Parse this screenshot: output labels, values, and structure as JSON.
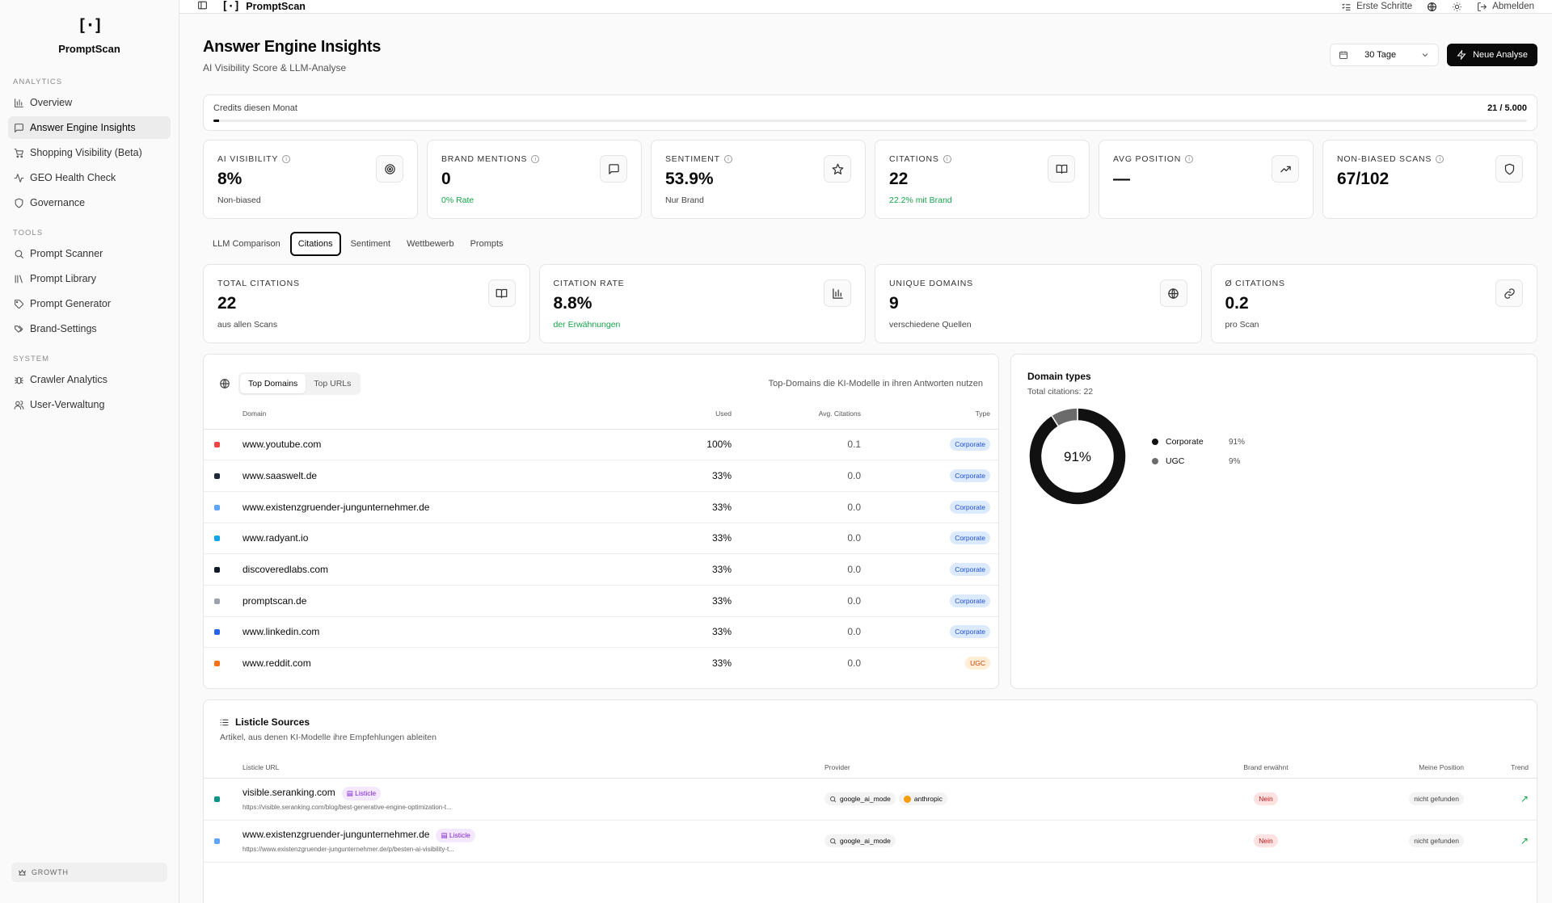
{
  "app": {
    "name": "PromptScan",
    "logo": "[·]"
  },
  "sidebar": {
    "sections": [
      {
        "heading": "ANALYTICS",
        "items": [
          {
            "label": "Overview",
            "icon": "bar-chart-icon"
          },
          {
            "label": "Answer Engine Insights",
            "icon": "message-square-icon",
            "active": true
          },
          {
            "label": "Shopping Visibility (Beta)",
            "icon": "cart-icon"
          },
          {
            "label": "GEO Health Check",
            "icon": "activity-icon"
          },
          {
            "label": "Governance",
            "icon": "shield-icon"
          }
        ]
      },
      {
        "heading": "TOOLS",
        "items": [
          {
            "label": "Prompt Scanner",
            "icon": "search-icon"
          },
          {
            "label": "Prompt Library",
            "icon": "library-icon"
          },
          {
            "label": "Prompt Generator",
            "icon": "tag-icon"
          },
          {
            "label": "Brand-Settings",
            "icon": "tags-icon"
          }
        ]
      },
      {
        "heading": "SYSTEM",
        "items": [
          {
            "label": "Crawler Analytics",
            "icon": "bug-icon"
          },
          {
            "label": "User-Verwaltung",
            "icon": "users-icon"
          }
        ]
      }
    ],
    "growth": "GROWTH"
  },
  "topbar": {
    "title": "PromptScan",
    "first_steps": "Erste Schritte",
    "logout": "Abmelden"
  },
  "page": {
    "title": "Answer Engine Insights",
    "subtitle": "AI Visibility Score & LLM-Analyse"
  },
  "range": {
    "selected": "30 Tage"
  },
  "new_analysis": "Neue Analyse",
  "credits": {
    "label": "Credits diesen Monat",
    "value": "21 / 5.000",
    "used_fraction": 0.0042
  },
  "kpis": [
    {
      "label": "AI VISIBILITY",
      "value": "8%",
      "sub": "Non-biased",
      "green": false,
      "icon": "target-icon"
    },
    {
      "label": "BRAND MENTIONS",
      "value": "0",
      "sub": "0% Rate",
      "green": true,
      "icon": "message-square-icon"
    },
    {
      "label": "SENTIMENT",
      "value": "53.9%",
      "sub": "Nur Brand",
      "green": false,
      "icon": "star-icon"
    },
    {
      "label": "CITATIONS",
      "value": "22",
      "sub": "22.2% mit Brand",
      "green": true,
      "icon": "book-icon"
    },
    {
      "label": "AVG POSITION",
      "value": "—",
      "sub": "",
      "green": false,
      "icon": "trending-up-icon"
    },
    {
      "label": "NON-BIASED SCANS",
      "value": "67/102",
      "sub": "",
      "green": false,
      "icon": "shield-icon"
    }
  ],
  "tabs": [
    "LLM Comparison",
    "Citations",
    "Sentiment",
    "Wettbewerb",
    "Prompts"
  ],
  "active_tab": 1,
  "citation_kpis": [
    {
      "label": "TOTAL CITATIONS",
      "value": "22",
      "sub": "aus allen Scans",
      "green": false,
      "icon": "book-icon"
    },
    {
      "label": "CITATION RATE",
      "value": "8.8%",
      "sub": "der Erwähnungen",
      "green": true,
      "icon": "bar-chart-icon"
    },
    {
      "label": "UNIQUE DOMAINS",
      "value": "9",
      "sub": "verschiedene Quellen",
      "green": false,
      "icon": "globe-icon"
    },
    {
      "label": "Ø CITATIONS",
      "value": "0.2",
      "sub": "pro Scan",
      "green": false,
      "icon": "link-icon"
    }
  ],
  "domains": {
    "seg": [
      "Top Domains",
      "Top URLs"
    ],
    "note": "Top-Domains die KI-Modelle in ihren Antworten nutzen",
    "headers": {
      "domain": "Domain",
      "used": "Used",
      "avg": "Avg. Citations",
      "type": "Type"
    },
    "rows": [
      {
        "domain": "www.youtube.com",
        "used": "100%",
        "avg": "0.1",
        "type": "Corporate",
        "color": "#ef4444"
      },
      {
        "domain": "www.saaswelt.de",
        "used": "33%",
        "avg": "0.0",
        "type": "Corporate",
        "color": "#1f2937"
      },
      {
        "domain": "www.existenzgruender-jungunternehmer.de",
        "used": "33%",
        "avg": "0.0",
        "type": "Corporate",
        "color": "#60a5fa"
      },
      {
        "domain": "www.radyant.io",
        "used": "33%",
        "avg": "0.0",
        "type": "Corporate",
        "color": "#0ea5e9"
      },
      {
        "domain": "discoveredlabs.com",
        "used": "33%",
        "avg": "0.0",
        "type": "Corporate",
        "color": "#111827"
      },
      {
        "domain": "promptscan.de",
        "used": "33%",
        "avg": "0.0",
        "type": "Corporate",
        "color": "#9ca3af"
      },
      {
        "domain": "www.linkedin.com",
        "used": "33%",
        "avg": "0.0",
        "type": "Corporate",
        "color": "#2563eb"
      },
      {
        "domain": "www.reddit.com",
        "used": "33%",
        "avg": "0.0",
        "type": "UGC",
        "color": "#f97316"
      }
    ]
  },
  "domain_types": {
    "title": "Domain types",
    "sub": "Total citations: 22",
    "center": "91%",
    "slices": [
      {
        "label": "Corporate",
        "pct_text": "91%",
        "value": 91,
        "color": "#111111"
      },
      {
        "label": "UGC",
        "pct_text": "9%",
        "value": 9,
        "color": "#6b6b6b"
      }
    ]
  },
  "listicle": {
    "title": "Listicle Sources",
    "sub": "Artikel, aus denen KI-Modelle ihre Empfehlungen ableiten",
    "headers": {
      "url": "Listicle URL",
      "provider": "Provider",
      "brand": "Brand erwähnt",
      "pos": "Meine Position",
      "trend": "Trend"
    },
    "rows": [
      {
        "domain": "visible.seranking.com",
        "tag": "Listicle",
        "url": "https://visible.seranking.com/blog/best-generative-engine-optimization-t...",
        "providers": [
          "google_ai_mode",
          "anthropic"
        ],
        "brand": "Nein",
        "pos": "nicht gefunden",
        "color": "#0d9488"
      },
      {
        "domain": "www.existenzgruender-jungunternehmer.de",
        "tag": "Listicle",
        "url": "https://www.existenzgruender-jungunternehmer.de/p/besten-ai-visibility-t...",
        "providers": [
          "google_ai_mode"
        ],
        "brand": "Nein",
        "pos": "nicht gefunden",
        "color": "#60a5fa"
      }
    ]
  }
}
